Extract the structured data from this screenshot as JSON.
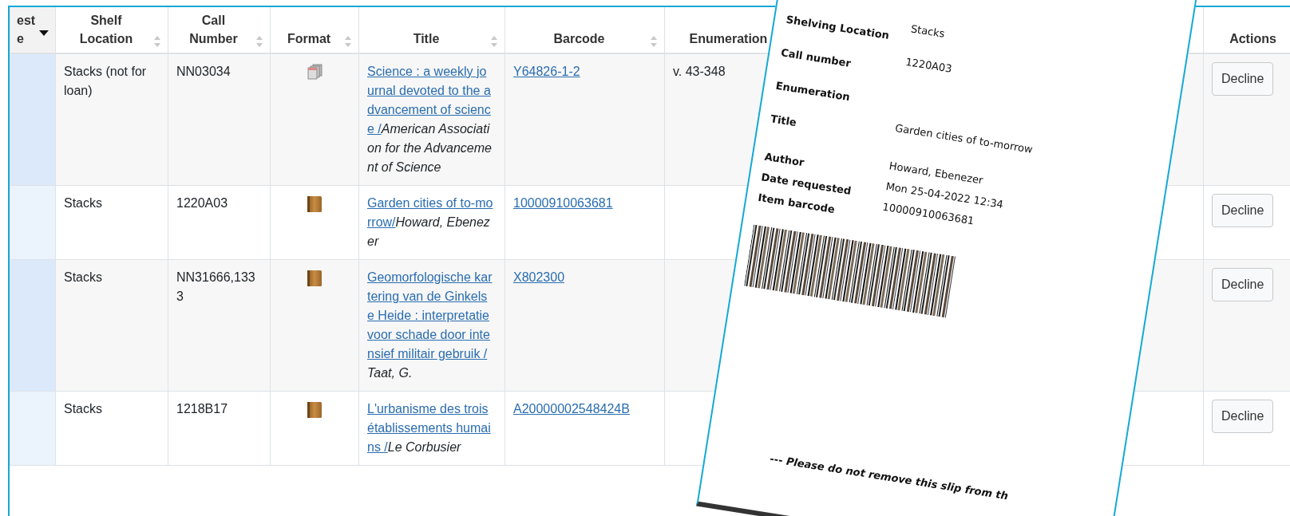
{
  "table": {
    "columns": [
      {
        "label": "est e",
        "kind": "sorted_desc"
      },
      {
        "label": "Shelf Location",
        "kind": "sort"
      },
      {
        "label": "Call Number",
        "kind": "sort"
      },
      {
        "label": "Format",
        "kind": "sort"
      },
      {
        "label": "Title",
        "kind": "sort"
      },
      {
        "label": "Barcode",
        "kind": "sort"
      },
      {
        "label": "Enumeration",
        "kind": "none"
      },
      {
        "kind": "none"
      },
      {
        "label": "Actions",
        "kind": "none"
      }
    ],
    "rows": [
      {
        "shelf_location": "Stacks (not for loan)",
        "call_number": "NN03034",
        "format": {
          "kind": "serial"
        },
        "title": "Science : a weekly journal devoted to the advancement of science /",
        "author": "American Association for the Advancement of Science",
        "barcode": "Y64826-1-2",
        "enumeration": "v. 43-348",
        "action": "Decline"
      },
      {
        "shelf_location": "Stacks",
        "call_number": "1220A03",
        "format": {
          "kind": "book"
        },
        "title": "Garden cities of to-morrow/",
        "author": "Howard, Ebenezer",
        "barcode": "10000910063681",
        "action": "Decline"
      },
      {
        "shelf_location": "Stacks",
        "call_number": "NN31666,1333",
        "format": {
          "kind": "book"
        },
        "title": "Geomorfologische kartering van de Ginkelse Heide : interpretatie voor schade door intensief militair gebruik /",
        "author": "Taat, G.",
        "barcode": "X802300",
        "action": "Decline"
      },
      {
        "shelf_location": "Stacks",
        "call_number": "1218B17",
        "format": {
          "kind": "book"
        },
        "title": "L'urbanisme des trois établissements humains /",
        "author": "Le Corbusier",
        "barcode": "A20000002548424B",
        "action": "Decline"
      }
    ]
  },
  "slip": {
    "fields": [
      {
        "label": "Shelving Location",
        "value": "Stacks"
      },
      {
        "label": "Call number",
        "value": "1220A03"
      },
      {
        "label": "Enumeration"
      },
      {
        "label": "Title",
        "value": "Garden cities of to-morrow"
      },
      {
        "label": "Author",
        "value": "Howard, Ebenezer"
      },
      {
        "label": "Date requested",
        "value": "Mon 25-04-2022 12:34"
      },
      {
        "label": "Item barcode",
        "value": "10000910063681"
      }
    ],
    "footer": "--- Please do not remove this slip from th"
  }
}
